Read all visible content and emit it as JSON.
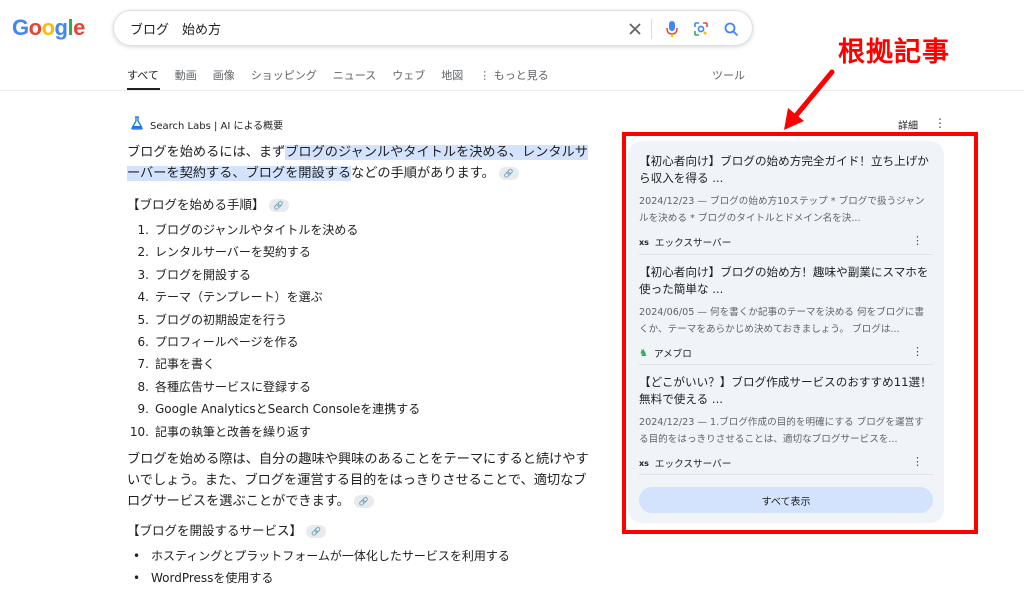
{
  "logo": {
    "letters": [
      "G",
      "o",
      "o",
      "g",
      "l",
      "e"
    ],
    "colors": [
      "#4285F4",
      "#EA4335",
      "#FBBC05",
      "#4285F4",
      "#34A853",
      "#EA4335"
    ]
  },
  "search": {
    "query": "ブログ　始め方",
    "icons": [
      "close-icon",
      "mic-icon",
      "lens-icon",
      "search-icon"
    ]
  },
  "tabs": [
    "すべて",
    "動画",
    "画像",
    "ショッピング",
    "ニュース",
    "ウェブ",
    "地図",
    "⋮ もっと見る"
  ],
  "tools_label": "ツール",
  "ai_overview": {
    "label": "Search Labs | AI による概要",
    "details_label": "詳細",
    "intro_pre": "ブログを始めるには、まず",
    "intro_hl": "ブログのジャンルやタイトルを決める、レンタルサーバーを契約する、ブログを開設する",
    "intro_post": "などの手順があります。",
    "steps_heading": "【ブログを始める手順】",
    "steps": [
      "ブログのジャンルやタイトルを決める",
      "レンタルサーバーを契約する",
      "ブログを開設する",
      "テーマ（テンプレート）を選ぶ",
      "ブログの初期設定を行う",
      "プロフィールページを作る",
      "記事を書く",
      "各種広告サービスに登録する",
      "Google AnalyticsとSearch Consoleを連携する",
      "記事の執筆と改善を繰り返す"
    ],
    "para2": "ブログを始める際は、自分の趣味や興味のあることをテーマにすると続けやすいでしょう。また、ブログを運営する目的をはっきりさせることで、適切なブログサービスを選ぶことができます。",
    "services_heading": "【ブログを開設するサービス】",
    "services": [
      "ホスティングとプラットフォームが一体化したサービスを利用する",
      "WordPressを使用する"
    ]
  },
  "sources": [
    {
      "title": "【初心者向け】ブログの始め方完全ガイド！立ち上げから収入を得る ...",
      "snippet": "2024/12/23 — ブログの始め方10ステップ * ブログで扱うジャンルを決める * ブログのタイトルとドメイン名を決...",
      "site": "エックスサーバー",
      "favicon": "xs"
    },
    {
      "title": "【初心者向け】ブログの始め方！趣味や副業にスマホを使った簡単な ...",
      "snippet": "2024/06/05 — 何を書くか記事のテーマを決める 何をブログに書くか、テーマをあらかじめ決めておきましょう。 ブログは...",
      "site": "アメブロ",
      "favicon": "♞"
    },
    {
      "title": "【どこがいい？】ブログ作成サービスのおすすめ11選！無料で使える ...",
      "snippet": "2024/12/23 — 1.ブログ作成の目的を明確にする ブログを運営する目的をはっきりさせることは、適切なブログサービスを...",
      "site": "エックスサーバー",
      "favicon": "xs"
    }
  ],
  "show_all_label": "すべて表示",
  "annotation": {
    "text": "根拠記事",
    "color": "#ff0000"
  }
}
